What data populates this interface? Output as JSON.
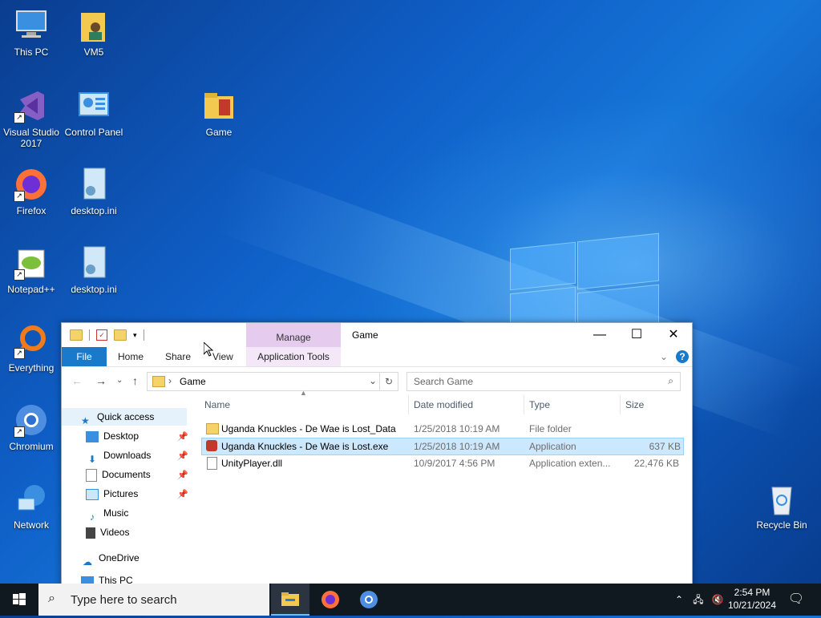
{
  "desktop": {
    "icons": [
      {
        "label": "This PC"
      },
      {
        "label": "VM5"
      },
      {
        "label": "Visual Studio 2017"
      },
      {
        "label": "Control Panel"
      },
      {
        "label": "Game"
      },
      {
        "label": "Firefox"
      },
      {
        "label": "desktop.ini"
      },
      {
        "label": "Notepad++"
      },
      {
        "label": "desktop.ini"
      },
      {
        "label": "Everything"
      },
      {
        "label": "Chromium"
      },
      {
        "label": "Network"
      },
      {
        "label": "Recycle Bin"
      }
    ]
  },
  "explorer": {
    "title": "Game",
    "manage_tab": "Manage",
    "ribbon": {
      "file": "File",
      "home": "Home",
      "share": "Share",
      "view": "View",
      "app_tools": "Application Tools"
    },
    "address": {
      "crumb": "Game"
    },
    "search": {
      "placeholder": "Search Game"
    },
    "nav": [
      {
        "label": "Quick access"
      },
      {
        "label": "Desktop"
      },
      {
        "label": "Downloads"
      },
      {
        "label": "Documents"
      },
      {
        "label": "Pictures"
      },
      {
        "label": "Music"
      },
      {
        "label": "Videos"
      },
      {
        "label": "OneDrive"
      },
      {
        "label": "This PC"
      }
    ],
    "columns": {
      "name": "Name",
      "date": "Date modified",
      "type": "Type",
      "size": "Size"
    },
    "files": [
      {
        "name": "Uganda Knuckles - De Wae is Lost_Data",
        "date": "1/25/2018 10:19 AM",
        "type": "File folder",
        "size": ""
      },
      {
        "name": "Uganda Knuckles - De Wae is Lost.exe",
        "date": "1/25/2018 10:19 AM",
        "type": "Application",
        "size": "637 KB"
      },
      {
        "name": "UnityPlayer.dll",
        "date": "10/9/2017 4:56 PM",
        "type": "Application exten...",
        "size": "22,476 KB"
      }
    ]
  },
  "taskbar": {
    "search_placeholder": "Type here to search",
    "time": "2:54 PM",
    "date": "10/21/2024"
  },
  "colors": {
    "accent": "#1979ca",
    "selection": "#cce8ff",
    "manage": "#e5cbee"
  }
}
